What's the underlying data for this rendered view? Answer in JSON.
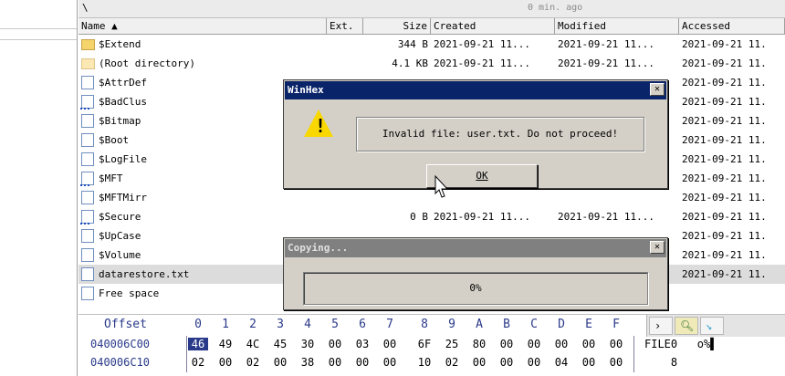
{
  "path": {
    "text": "\\",
    "status": "0 min. ago"
  },
  "columns": [
    "Name ▲",
    "Ext.",
    "Size",
    "Created",
    "Modified",
    "Accessed"
  ],
  "rows": [
    {
      "name": "$Extend",
      "ext": "",
      "size": "344 B",
      "created": "2021-09-21  11...",
      "modified": "2021-09-21  11...",
      "accessed": "2021-09-21  11.",
      "icon": "folder-icon",
      "selected": false
    },
    {
      "name": "(Root directory)",
      "ext": "",
      "size": "4.1 KB",
      "created": "2021-09-21  11...",
      "modified": "2021-09-21  11...",
      "accessed": "2021-09-21  11.",
      "icon": "root-folder-icon",
      "selected": false
    },
    {
      "name": "$AttrDef",
      "ext": "",
      "size": "",
      "created": "",
      "modified": "",
      "accessed": "2021-09-21  11.",
      "icon": "file-icon",
      "selected": false
    },
    {
      "name": "$BadClus",
      "ext": "",
      "size": "",
      "created": "",
      "modified": "",
      "accessed": "2021-09-21  11.",
      "icon": "file-sparse-icon",
      "selected": false
    },
    {
      "name": "$Bitmap",
      "ext": "",
      "size": "",
      "created": "",
      "modified": "",
      "accessed": "2021-09-21  11.",
      "icon": "file-icon",
      "selected": false
    },
    {
      "name": "$Boot",
      "ext": "",
      "size": "",
      "created": "",
      "modified": "",
      "accessed": "2021-09-21  11.",
      "icon": "file-icon",
      "selected": false
    },
    {
      "name": "$LogFile",
      "ext": "",
      "size": "",
      "created": "",
      "modified": "",
      "accessed": "2021-09-21  11.",
      "icon": "file-icon",
      "selected": false
    },
    {
      "name": "$MFT",
      "ext": "",
      "size": "",
      "created": "",
      "modified": "",
      "accessed": "2021-09-21  11.",
      "icon": "file-sparse-icon",
      "selected": false
    },
    {
      "name": "$MFTMirr",
      "ext": "",
      "size": "",
      "created": "",
      "modified": "",
      "accessed": "2021-09-21  11.",
      "icon": "file-icon",
      "selected": false
    },
    {
      "name": "$Secure",
      "ext": "",
      "size": "0 B",
      "created": "2021-09-21  11...",
      "modified": "2021-09-21  11...",
      "accessed": "2021-09-21  11.",
      "icon": "file-sparse-icon",
      "selected": false
    },
    {
      "name": "$UpCase",
      "ext": "",
      "size": "",
      "created": "",
      "modified": "",
      "accessed": "2021-09-21  11.",
      "icon": "file-icon",
      "selected": false
    },
    {
      "name": "$Volume",
      "ext": "",
      "size": "",
      "created": "",
      "modified": "",
      "accessed": "2021-09-21  11.",
      "icon": "file-icon",
      "selected": false
    },
    {
      "name": "datarestore.txt",
      "ext": "",
      "size": "",
      "created": "",
      "modified": "",
      "accessed": "2021-09-21  11.",
      "icon": "file-icon",
      "selected": true
    },
    {
      "name": "Free space",
      "ext": "",
      "size": "",
      "created": "",
      "modified": "",
      "accessed": "",
      "icon": "file-icon",
      "selected": false
    }
  ],
  "hex": {
    "offset_label": "Offset",
    "columns": [
      "0",
      "1",
      "2",
      "3",
      "4",
      "5",
      "6",
      "7",
      "8",
      "9",
      "A",
      "B",
      "C",
      "D",
      "E",
      "F"
    ],
    "rows": [
      {
        "addr": "040006C00",
        "bytes": [
          "46",
          "49",
          "4C",
          "45",
          "30",
          "00",
          "03",
          "00",
          "6F",
          "25",
          "80",
          "00",
          "00",
          "00",
          "00",
          "00"
        ],
        "text": "FILE0   o%▌"
      },
      {
        "addr": "040006C10",
        "bytes": [
          "02",
          "00",
          "02",
          "00",
          "38",
          "00",
          "00",
          "00",
          "10",
          "02",
          "00",
          "00",
          "00",
          "04",
          "00",
          "00"
        ],
        "text": "    8"
      }
    ]
  },
  "winhex_dialog": {
    "title": "WinHex",
    "message": "Invalid file: user.txt. Do not proceed!",
    "ok_label": "OK"
  },
  "copy_dialog": {
    "title": "Copying...",
    "progress_text": "0%",
    "progress": 0
  },
  "colors": {
    "title_active": "#0a246a",
    "title_inactive": "#808080",
    "dialog_bg": "#d4d0c8",
    "selection": "#dcdcdc"
  }
}
